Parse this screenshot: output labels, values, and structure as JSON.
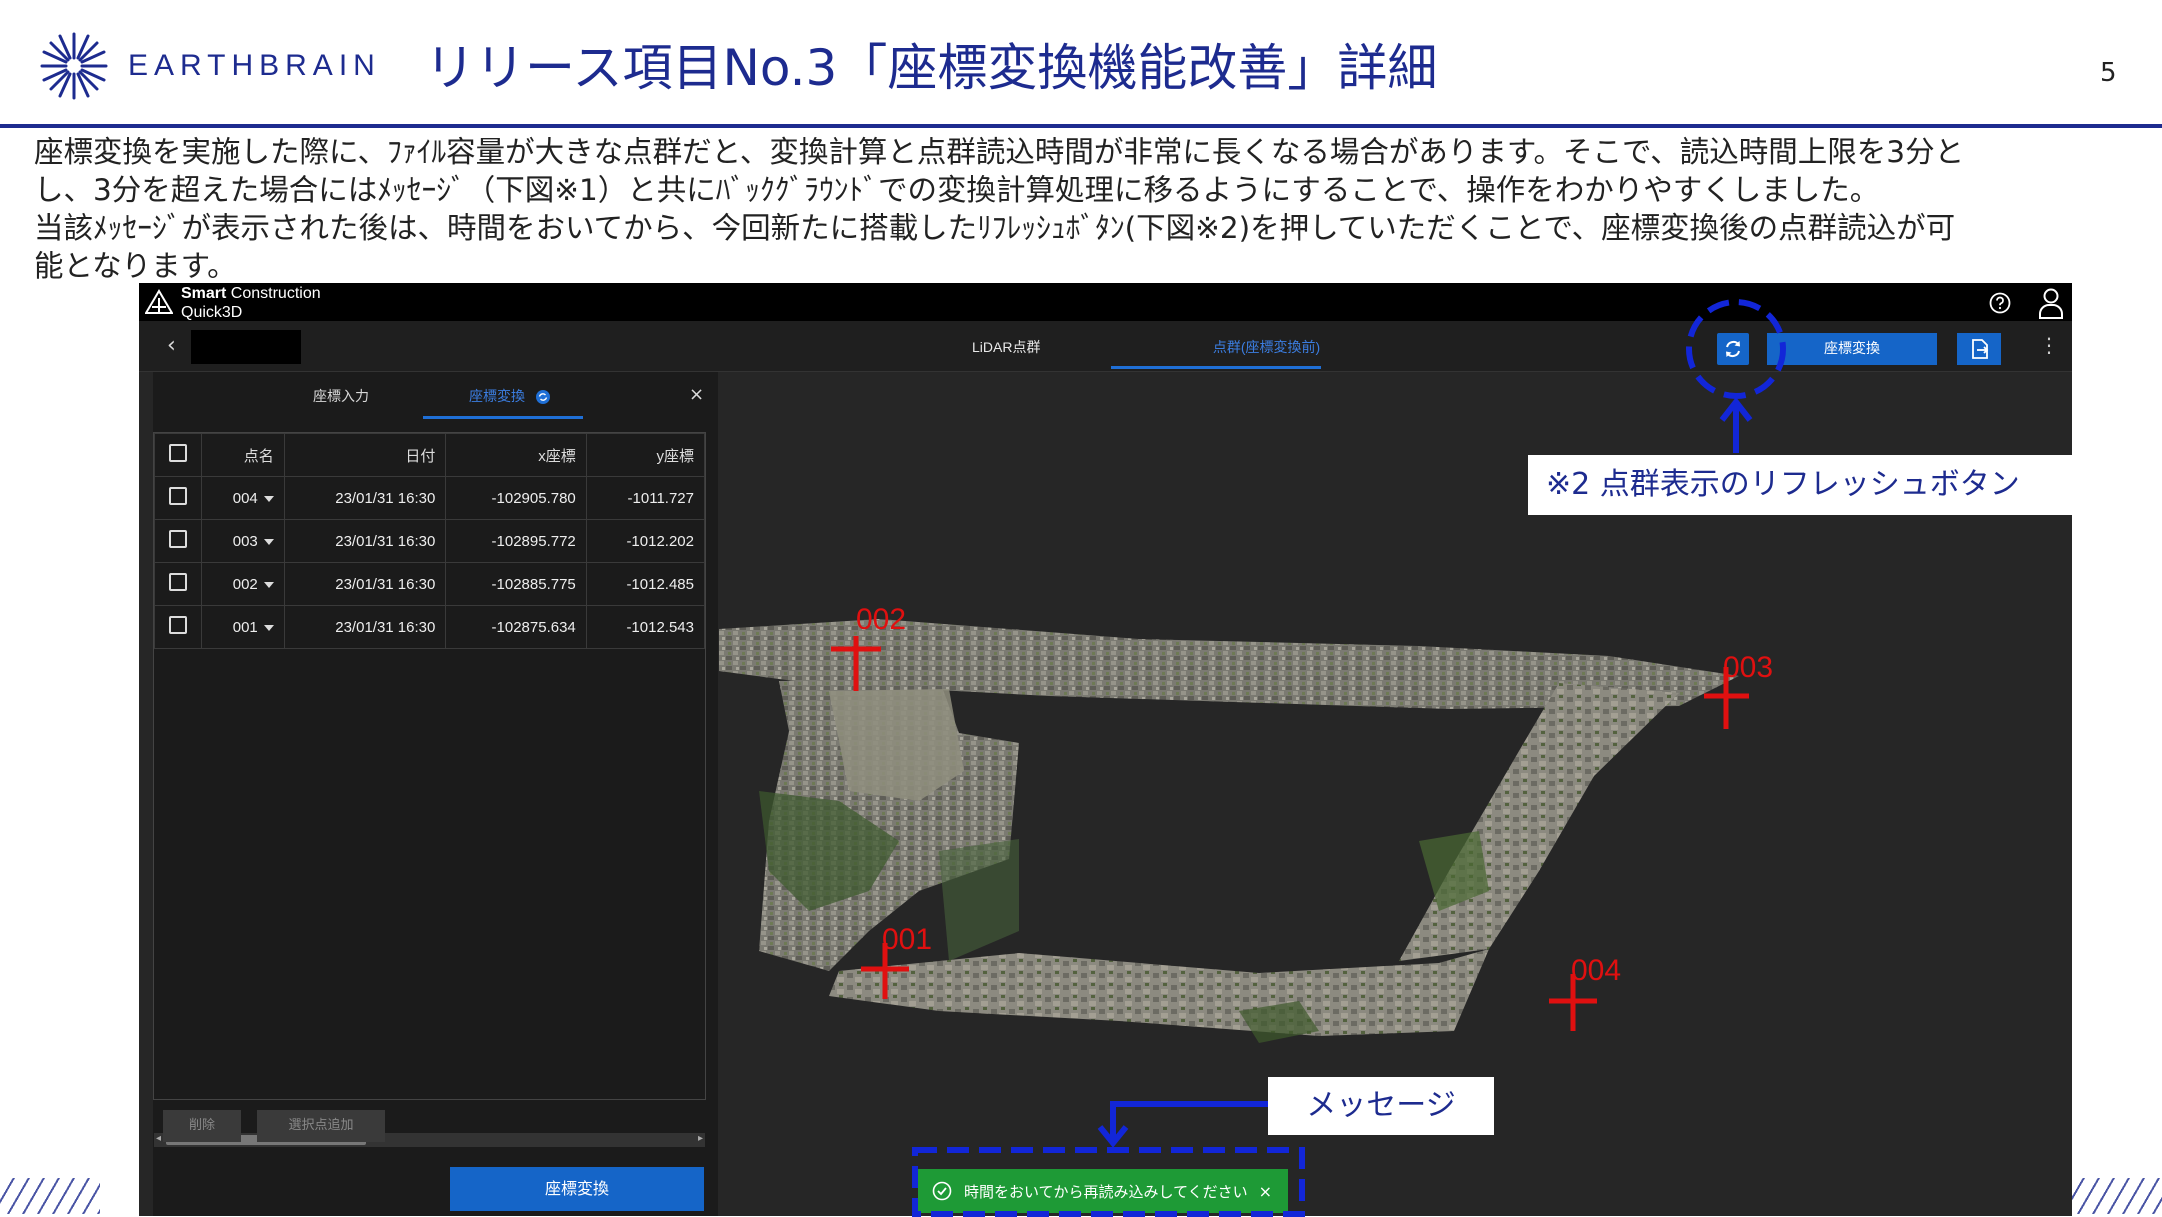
{
  "slide": {
    "logo_text": "EARTHBRAIN",
    "title": "リリース項目No.3「座標変換機能改善」詳細",
    "page_number": "5",
    "description": [
      "座標変換を実施した際に、ﾌｧｲﾙ容量が大きな点群だと、変換計算と点群読込時間が非常に長くなる場合があります。そこで、読込時間上限を3分と",
      "し、3分を超えた場合にはﾒｯｾｰｼﾞ（下図※1）と共にﾊﾞｯｸｸﾞﾗｳﾝﾄﾞでの変換計算処理に移るようにすることで、操作をわかりやすくしました。",
      "当該ﾒｯｾｰｼﾞが表示された後は、時間をおいてから、今回新たに搭載したﾘﾌﾚｯｼｭﾎﾞﾀﾝ(下図※2)を押していただくことで、座標変換後の点群読込が可",
      "能となります。"
    ]
  },
  "app": {
    "name_line1_bold": "Smart",
    "name_line1_rest": " Construction",
    "name_line2": "Quick3D",
    "back": "‹",
    "tabs": {
      "lidar": "LiDAR点群",
      "pointcloud": "点群(座標変換前)"
    },
    "convert_button": "座標変換",
    "kebab": "⋮",
    "panel": {
      "tab_input": "座標入力",
      "tab_convert": "座標変換",
      "close": "×",
      "columns": [
        "点名",
        "日付",
        "x座標",
        "y座標"
      ],
      "rows": [
        {
          "name": "004",
          "date": "23/01/31 16:30",
          "x": "-102905.780",
          "y": "-1011.727"
        },
        {
          "name": "003",
          "date": "23/01/31 16:30",
          "x": "-102895.772",
          "y": "-1012.202"
        },
        {
          "name": "002",
          "date": "23/01/31 16:30",
          "x": "-102885.775",
          "y": "-1012.485"
        },
        {
          "name": "001",
          "date": "23/01/31 16:30",
          "x": "-102875.634",
          "y": "-1012.543"
        }
      ],
      "delete_button": "削除",
      "add_selected_button": "選択点追加",
      "convert_button": "座標変換"
    },
    "markers": [
      "002",
      "003",
      "001",
      "004"
    ],
    "toast": {
      "text": "時間をおいてから再読み込みしてください",
      "close": "×"
    }
  },
  "annotations": {
    "refresh_note": "※2 点群表示のリフレッシュボタン",
    "message_note": "メッセージ"
  },
  "colors": {
    "brand": "#1d2b8f",
    "accent": "#1565c8",
    "toast": "#1e9a36",
    "marker": "#e01010",
    "annotation": "#1226d8"
  }
}
